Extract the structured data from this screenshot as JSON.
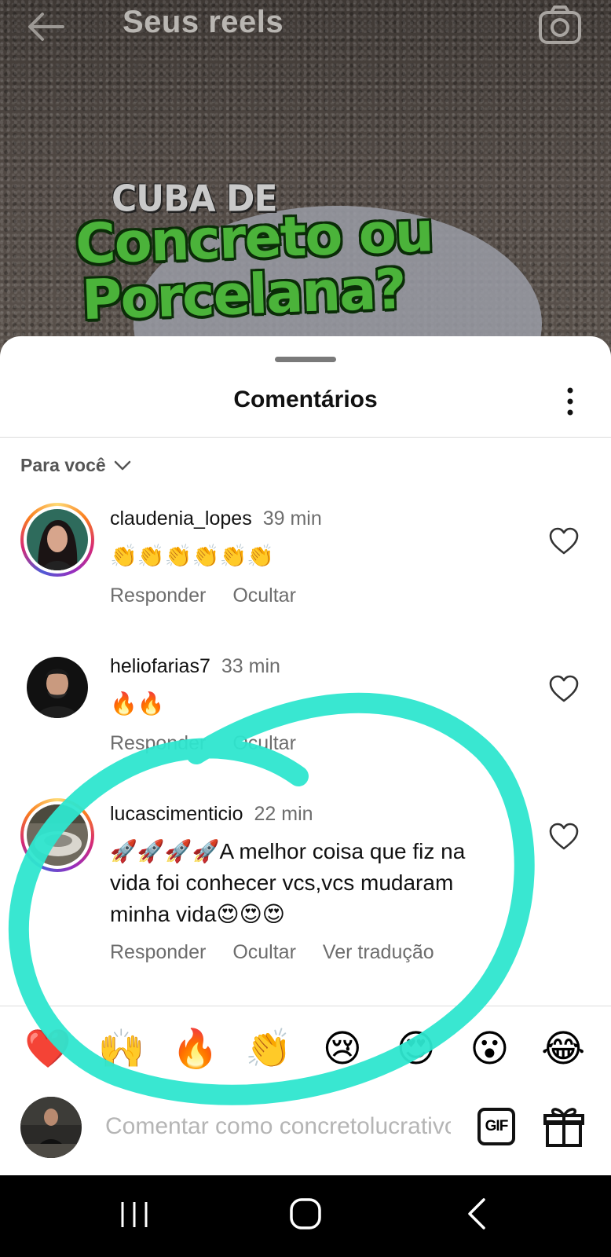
{
  "header": {
    "title": "Seus reels",
    "back_icon": "arrow-left-icon",
    "camera_icon": "camera-icon"
  },
  "video": {
    "headline_small": "CUBA DE",
    "headline_line1": "Concreto ou",
    "headline_line2": "Porcelana?"
  },
  "sheet": {
    "title": "Comentários",
    "sort_label": "Para você"
  },
  "comments": [
    {
      "username": "claudenia_lopes",
      "time": "39 min",
      "text": "👏👏👏👏👏👏",
      "actions": [
        "Responder",
        "Ocultar"
      ]
    },
    {
      "username": "heliofarias7",
      "time": "33 min",
      "text": "🔥🔥",
      "actions": [
        "Responder",
        "Ocultar"
      ]
    },
    {
      "username": "lucascimenticio",
      "time": "22 min",
      "text": "🚀🚀🚀🚀A melhor coisa que fiz na vida foi conhecer vcs,vcs mudaram minha vida😍😍😍",
      "actions": [
        "Responder",
        "Ocultar",
        "Ver tradução"
      ]
    }
  ],
  "emoji_bar": [
    "❤️",
    "🙌",
    "🔥",
    "👏",
    "😢",
    "😍",
    "😮",
    "😂"
  ],
  "composer": {
    "placeholder": "Comentar como concretolucrativo",
    "gif_label": "GIF"
  },
  "colors": {
    "annotation": "#2ee6cf",
    "headline_green": "#4bb33a",
    "muted_text": "#6d6d6d"
  }
}
